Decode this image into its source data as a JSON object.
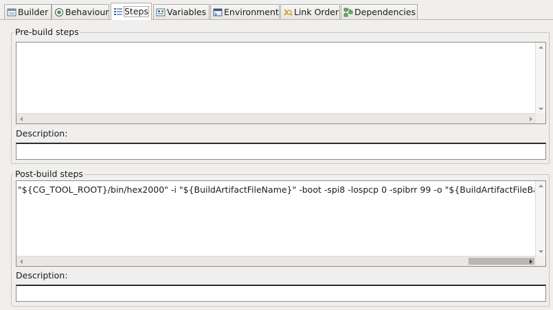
{
  "tabs": [
    {
      "label": "Builder",
      "icon": "builder-icon"
    },
    {
      "label": "Behaviour",
      "icon": "behaviour-icon"
    },
    {
      "label": "Steps",
      "icon": "steps-icon"
    },
    {
      "label": "Variables",
      "icon": "variables-icon"
    },
    {
      "label": "Environment",
      "icon": "environment-icon"
    },
    {
      "label": "Link Order",
      "icon": "link-order-icon"
    },
    {
      "label": "Dependencies",
      "icon": "dependencies-icon"
    }
  ],
  "active_tab": "Steps",
  "pre_build": {
    "title": "Pre-build steps",
    "command": "",
    "description_label": "Description:",
    "description_value": ""
  },
  "post_build": {
    "title": "Post-build steps",
    "command": "\"${CG_TOOL_ROOT}/bin/hex2000\" -i \"${BuildArtifactFileName}\" -boot -spi8 -lospcp 0 -spibrr 99 -o \"${BuildArtifactFileBaseName}.hex\"",
    "description_label": "Description:",
    "description_value": ""
  },
  "colors": {
    "window_bg": "#f0efee",
    "field_bg": "#ffffff",
    "group_border": "#c9c7c3"
  }
}
